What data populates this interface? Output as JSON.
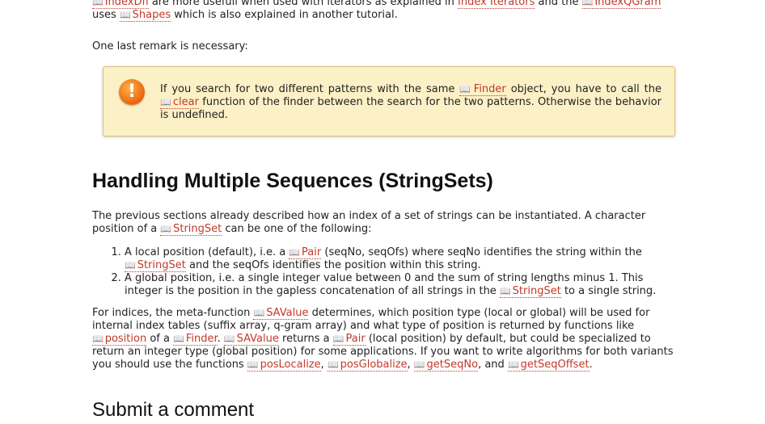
{
  "intro": {
    "ref_indexdfi": "IndexDfi",
    "t1": "are more usefull when used with iterators as explained in",
    "link_index_iterators": "Index Iterators",
    "t2": "and the",
    "ref_indexqgram": "IndexQGram",
    "t3": "uses",
    "ref_shapes": "Shapes",
    "t4": "which is also explained in another tutorial."
  },
  "remark": "One last remark is necessary:",
  "warning": {
    "icon": "!",
    "t1": "If you search for two different patterns with the same",
    "ref_finder": "Finder",
    "t2": "object, you have to call the",
    "ref_clear": "clear",
    "t3": "function of the finder between the search for the two patterns. Otherwise the behavior is undefined."
  },
  "heading": "Handling Multiple Sequences (StringSets)",
  "para1": {
    "t1": "The previous sections already described how an index of a set of strings can be instantiated. A character position of a",
    "ref_stringset": "StringSet",
    "t2": "can be one of the following:"
  },
  "list": {
    "item1": {
      "t1": "A local position (default), i.e. a",
      "ref_pair": "Pair",
      "t2": "(seqNo, seqOfs) where seqNo identifies the string within the",
      "ref_stringset": "StringSet",
      "t3": "and the seqOfs identifies the position within this string."
    },
    "item2": {
      "t1": "A global position, i.e. a single integer value between 0 and the sum of string lengths minus 1. This integer is the position in the gapless concatenation of all strings in the",
      "ref_stringset": "StringSet",
      "t2": "to a single string."
    }
  },
  "para2": {
    "t1": "For indices, the meta-function",
    "ref_savalue": "SAValue",
    "t2": "determines, which position type (local or global) will be used for internal index tables (suffix array, q-gram array) and what type of position is returned by functions like",
    "ref_position": "position",
    "t3": "of a",
    "ref_finder": "Finder",
    "t4": ".",
    "ref_savalue2": "SAValue",
    "t5": "returns a",
    "ref_pair": "Pair",
    "t6": "(local position) by default, but could be specialized to return an integer type (global position) for some applications. If you want to write algorithms for both variants you should use the functions",
    "ref_poslocalize": "posLocalize",
    "sep1": ",",
    "ref_posglobalize": "posGlobalize",
    "sep2": ",",
    "ref_getseqno": "getSeqNo",
    "sep3": ", and",
    "ref_getseqoffset": "getSeqOffset",
    "end": "."
  },
  "submit_heading": "Submit a comment"
}
